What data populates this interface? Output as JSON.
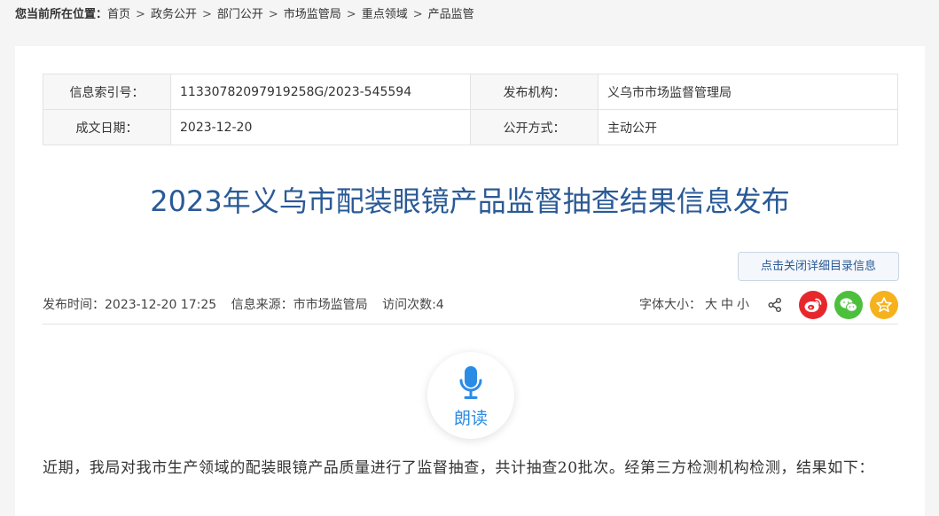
{
  "breadcrumb": {
    "label": "您当前所在位置：",
    "items": [
      "首页",
      "政务公开",
      "部门公开",
      "市场监管局",
      "重点领域",
      "产品监管"
    ],
    "separator": ">"
  },
  "meta": {
    "index_label": "信息索引号：",
    "index_value": "11330782097919258G/2023-545594",
    "publisher_label": "发布机构：",
    "publisher_value": "义乌市市场监督管理局",
    "date_label": "成文日期：",
    "date_value": "2023-12-20",
    "disclosure_label": "公开方式：",
    "disclosure_value": "主动公开"
  },
  "article": {
    "title": "2023年义乌市配装眼镜产品监督抽查结果信息发布",
    "toggle_button": "点击关闭详细目录信息",
    "publish_time": "发布时间：2023-12-20 17:25",
    "source": "信息来源：市市场监管局",
    "visits": "访问次数:4",
    "font_size_label": "字体大小：",
    "font_size_options": [
      "大",
      "中",
      "小"
    ],
    "read_aloud": "朗读",
    "body": "近期，我局对我市生产领域的配装眼镜产品质量进行了监督抽查，共计抽查20批次。经第三方检测机构检测，结果如下："
  },
  "icons": {
    "share": "share-icon",
    "weibo": "weibo-icon",
    "wechat": "wechat-icon",
    "favorite": "star-icon",
    "microphone": "microphone-icon"
  },
  "colors": {
    "title": "#2a5a96",
    "weibo": "#e6282d",
    "wechat": "#4cbf3c",
    "favorite": "#f5b21d",
    "read_aloud": "#2b8ce6"
  }
}
